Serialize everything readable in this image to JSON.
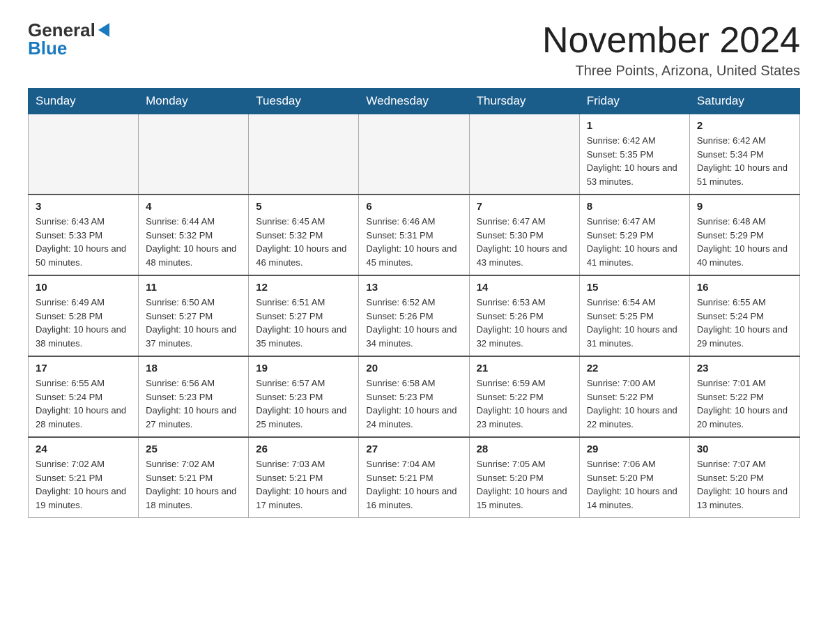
{
  "logo": {
    "general": "General",
    "blue": "Blue"
  },
  "title": "November 2024",
  "subtitle": "Three Points, Arizona, United States",
  "weekdays": [
    "Sunday",
    "Monday",
    "Tuesday",
    "Wednesday",
    "Thursday",
    "Friday",
    "Saturday"
  ],
  "weeks": [
    [
      {
        "day": "",
        "info": ""
      },
      {
        "day": "",
        "info": ""
      },
      {
        "day": "",
        "info": ""
      },
      {
        "day": "",
        "info": ""
      },
      {
        "day": "",
        "info": ""
      },
      {
        "day": "1",
        "info": "Sunrise: 6:42 AM\nSunset: 5:35 PM\nDaylight: 10 hours and 53 minutes."
      },
      {
        "day": "2",
        "info": "Sunrise: 6:42 AM\nSunset: 5:34 PM\nDaylight: 10 hours and 51 minutes."
      }
    ],
    [
      {
        "day": "3",
        "info": "Sunrise: 6:43 AM\nSunset: 5:33 PM\nDaylight: 10 hours and 50 minutes."
      },
      {
        "day": "4",
        "info": "Sunrise: 6:44 AM\nSunset: 5:32 PM\nDaylight: 10 hours and 48 minutes."
      },
      {
        "day": "5",
        "info": "Sunrise: 6:45 AM\nSunset: 5:32 PM\nDaylight: 10 hours and 46 minutes."
      },
      {
        "day": "6",
        "info": "Sunrise: 6:46 AM\nSunset: 5:31 PM\nDaylight: 10 hours and 45 minutes."
      },
      {
        "day": "7",
        "info": "Sunrise: 6:47 AM\nSunset: 5:30 PM\nDaylight: 10 hours and 43 minutes."
      },
      {
        "day": "8",
        "info": "Sunrise: 6:47 AM\nSunset: 5:29 PM\nDaylight: 10 hours and 41 minutes."
      },
      {
        "day": "9",
        "info": "Sunrise: 6:48 AM\nSunset: 5:29 PM\nDaylight: 10 hours and 40 minutes."
      }
    ],
    [
      {
        "day": "10",
        "info": "Sunrise: 6:49 AM\nSunset: 5:28 PM\nDaylight: 10 hours and 38 minutes."
      },
      {
        "day": "11",
        "info": "Sunrise: 6:50 AM\nSunset: 5:27 PM\nDaylight: 10 hours and 37 minutes."
      },
      {
        "day": "12",
        "info": "Sunrise: 6:51 AM\nSunset: 5:27 PM\nDaylight: 10 hours and 35 minutes."
      },
      {
        "day": "13",
        "info": "Sunrise: 6:52 AM\nSunset: 5:26 PM\nDaylight: 10 hours and 34 minutes."
      },
      {
        "day": "14",
        "info": "Sunrise: 6:53 AM\nSunset: 5:26 PM\nDaylight: 10 hours and 32 minutes."
      },
      {
        "day": "15",
        "info": "Sunrise: 6:54 AM\nSunset: 5:25 PM\nDaylight: 10 hours and 31 minutes."
      },
      {
        "day": "16",
        "info": "Sunrise: 6:55 AM\nSunset: 5:24 PM\nDaylight: 10 hours and 29 minutes."
      }
    ],
    [
      {
        "day": "17",
        "info": "Sunrise: 6:55 AM\nSunset: 5:24 PM\nDaylight: 10 hours and 28 minutes."
      },
      {
        "day": "18",
        "info": "Sunrise: 6:56 AM\nSunset: 5:23 PM\nDaylight: 10 hours and 27 minutes."
      },
      {
        "day": "19",
        "info": "Sunrise: 6:57 AM\nSunset: 5:23 PM\nDaylight: 10 hours and 25 minutes."
      },
      {
        "day": "20",
        "info": "Sunrise: 6:58 AM\nSunset: 5:23 PM\nDaylight: 10 hours and 24 minutes."
      },
      {
        "day": "21",
        "info": "Sunrise: 6:59 AM\nSunset: 5:22 PM\nDaylight: 10 hours and 23 minutes."
      },
      {
        "day": "22",
        "info": "Sunrise: 7:00 AM\nSunset: 5:22 PM\nDaylight: 10 hours and 22 minutes."
      },
      {
        "day": "23",
        "info": "Sunrise: 7:01 AM\nSunset: 5:22 PM\nDaylight: 10 hours and 20 minutes."
      }
    ],
    [
      {
        "day": "24",
        "info": "Sunrise: 7:02 AM\nSunset: 5:21 PM\nDaylight: 10 hours and 19 minutes."
      },
      {
        "day": "25",
        "info": "Sunrise: 7:02 AM\nSunset: 5:21 PM\nDaylight: 10 hours and 18 minutes."
      },
      {
        "day": "26",
        "info": "Sunrise: 7:03 AM\nSunset: 5:21 PM\nDaylight: 10 hours and 17 minutes."
      },
      {
        "day": "27",
        "info": "Sunrise: 7:04 AM\nSunset: 5:21 PM\nDaylight: 10 hours and 16 minutes."
      },
      {
        "day": "28",
        "info": "Sunrise: 7:05 AM\nSunset: 5:20 PM\nDaylight: 10 hours and 15 minutes."
      },
      {
        "day": "29",
        "info": "Sunrise: 7:06 AM\nSunset: 5:20 PM\nDaylight: 10 hours and 14 minutes."
      },
      {
        "day": "30",
        "info": "Sunrise: 7:07 AM\nSunset: 5:20 PM\nDaylight: 10 hours and 13 minutes."
      }
    ]
  ]
}
